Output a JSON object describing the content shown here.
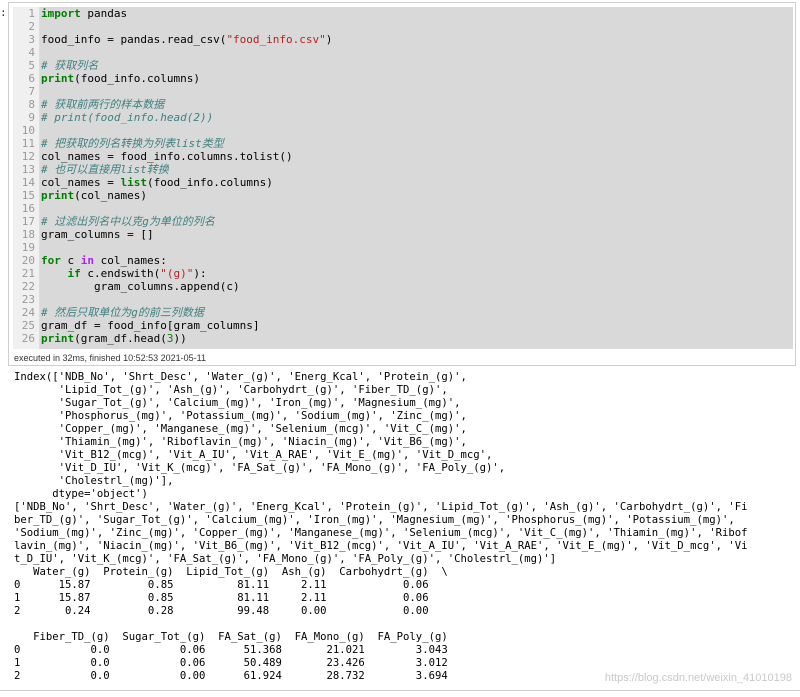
{
  "prompt": ":",
  "code_lines": [
    [
      [
        "kw",
        "import"
      ],
      [
        "t",
        " pandas"
      ]
    ],
    [],
    [
      [
        "t",
        "food_info = pandas.read_csv("
      ],
      [
        "str",
        "\"food_info.csv\""
      ],
      [
        "t",
        ")"
      ]
    ],
    [],
    [
      [
        "cm",
        "# 获取列名"
      ]
    ],
    [
      [
        "kw",
        "print"
      ],
      [
        "t",
        "(food_info.columns)"
      ]
    ],
    [],
    [
      [
        "cm",
        "# 获取前两行的样本数据"
      ]
    ],
    [
      [
        "cm",
        "# print(food_info.head(2))"
      ]
    ],
    [],
    [
      [
        "cm",
        "# 把获取的列名转换为列表list类型"
      ]
    ],
    [
      [
        "t",
        "col_names = food_info.columns.tolist()"
      ]
    ],
    [
      [
        "cm",
        "# 也可以直接用list转换"
      ]
    ],
    [
      [
        "t",
        "col_names = "
      ],
      [
        "kw",
        "list"
      ],
      [
        "t",
        "(food_info.columns)"
      ]
    ],
    [
      [
        "kw",
        "print"
      ],
      [
        "t",
        "(col_names)"
      ]
    ],
    [],
    [
      [
        "cm",
        "# 过滤出列名中以克g为单位的列名"
      ]
    ],
    [
      [
        "t",
        "gram_columns = []"
      ]
    ],
    [],
    [
      [
        "kw",
        "for"
      ],
      [
        "t",
        " c "
      ],
      [
        "op",
        "in"
      ],
      [
        "t",
        " col_names:"
      ]
    ],
    [
      [
        "t",
        "    "
      ],
      [
        "kw",
        "if"
      ],
      [
        "t",
        " c.endswith("
      ],
      [
        "str",
        "\"(g)\""
      ],
      [
        "t",
        "):"
      ]
    ],
    [
      [
        "t",
        "        gram_columns.append(c)"
      ]
    ],
    [],
    [
      [
        "cm",
        "# 然后只取单位为g的前三列数据"
      ]
    ],
    [
      [
        "t",
        "gram_df = food_info[gram_columns]"
      ]
    ],
    [
      [
        "kw",
        "print"
      ],
      [
        "t",
        "(gram_df.head("
      ],
      [
        "num",
        "3"
      ],
      [
        "t",
        "))"
      ]
    ]
  ],
  "exec_info": "executed in 32ms, finished 10:52:53 2021-05-11",
  "output_lines": [
    "Index(['NDB_No', 'Shrt_Desc', 'Water_(g)', 'Energ_Kcal', 'Protein_(g)',",
    "       'Lipid_Tot_(g)', 'Ash_(g)', 'Carbohydrt_(g)', 'Fiber_TD_(g)',",
    "       'Sugar_Tot_(g)', 'Calcium_(mg)', 'Iron_(mg)', 'Magnesium_(mg)',",
    "       'Phosphorus_(mg)', 'Potassium_(mg)', 'Sodium_(mg)', 'Zinc_(mg)',",
    "       'Copper_(mg)', 'Manganese_(mg)', 'Selenium_(mcg)', 'Vit_C_(mg)',",
    "       'Thiamin_(mg)', 'Riboflavin_(mg)', 'Niacin_(mg)', 'Vit_B6_(mg)',",
    "       'Vit_B12_(mcg)', 'Vit_A_IU', 'Vit_A_RAE', 'Vit_E_(mg)', 'Vit_D_mcg',",
    "       'Vit_D_IU', 'Vit_K_(mcg)', 'FA_Sat_(g)', 'FA_Mono_(g)', 'FA_Poly_(g)',",
    "       'Cholestrl_(mg)'],",
    "      dtype='object')",
    "['NDB_No', 'Shrt_Desc', 'Water_(g)', 'Energ_Kcal', 'Protein_(g)', 'Lipid_Tot_(g)', 'Ash_(g)', 'Carbohydrt_(g)', 'Fi",
    "ber_TD_(g)', 'Sugar_Tot_(g)', 'Calcium_(mg)', 'Iron_(mg)', 'Magnesium_(mg)', 'Phosphorus_(mg)', 'Potassium_(mg)',",
    "'Sodium_(mg)', 'Zinc_(mg)', 'Copper_(mg)', 'Manganese_(mg)', 'Selenium_(mcg)', 'Vit_C_(mg)', 'Thiamin_(mg)', 'Ribof",
    "lavin_(mg)', 'Niacin_(mg)', 'Vit_B6_(mg)', 'Vit_B12_(mcg)', 'Vit_A_IU', 'Vit_A_RAE', 'Vit_E_(mg)', 'Vit_D_mcg', 'Vi",
    "t_D_IU', 'Vit_K_(mcg)', 'FA_Sat_(g)', 'FA_Mono_(g)', 'FA_Poly_(g)', 'Cholestrl_(mg)']",
    "   Water_(g)  Protein_(g)  Lipid_Tot_(g)  Ash_(g)  Carbohydrt_(g)  \\",
    "0      15.87         0.85          81.11     2.11            0.06",
    "1      15.87         0.85          81.11     2.11            0.06",
    "2       0.24         0.28          99.48     0.00            0.00",
    "",
    "   Fiber_TD_(g)  Sugar_Tot_(g)  FA_Sat_(g)  FA_Mono_(g)  FA_Poly_(g)",
    "0           0.0           0.06      51.368       21.021        3.043",
    "1           0.0           0.06      50.489       23.426        3.012",
    "2           0.0           0.00      61.924       28.732        3.694"
  ],
  "watermark": "https://blog.csdn.net/weixin_41010198"
}
